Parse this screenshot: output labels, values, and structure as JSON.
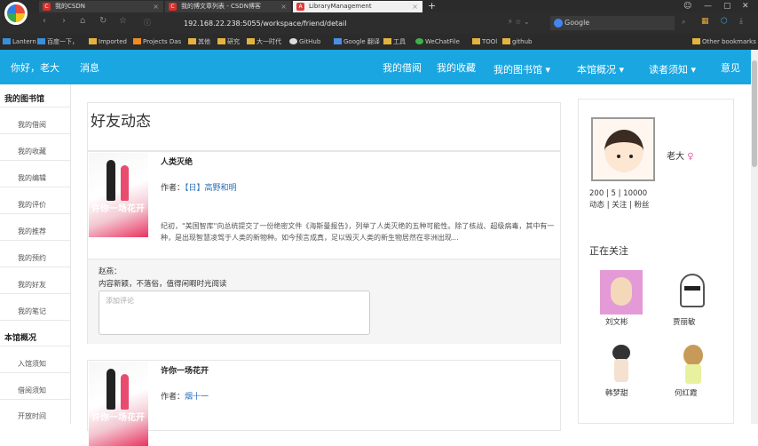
{
  "browser": {
    "tabs": [
      {
        "title": "我的CSDN",
        "active": false
      },
      {
        "title": "我的博文章列表 - CSDN博客",
        "active": false
      },
      {
        "title": "LibraryManagement",
        "active": true
      }
    ],
    "url": "192.168.22.238:5055/workspace/friend/detail",
    "search_placeholder": "Google",
    "bookmarks": [
      "Lantern",
      "百度一下，",
      "Imported",
      "Projects Das",
      "其他",
      "研究",
      "大一时代",
      "GitHub",
      "Google 翻译",
      "工具",
      "WeChatFile",
      "TOOl",
      "github",
      "Other bookmarks"
    ]
  },
  "topnav": {
    "greeting": "你好，老大",
    "messages": "消息",
    "my_borrow": "我的借阅",
    "my_favorites": "我的收藏",
    "my_library": "我的图书馆",
    "library_overview": "本馆概况",
    "reader_notice": "读者须知",
    "feedback": "意见"
  },
  "sidebar": {
    "section1": "我的图书馆",
    "items1": [
      "我的借阅",
      "我的收藏",
      "我的编辑",
      "我的评价",
      "我的推荐",
      "我的预约",
      "我的好友",
      "我的笔记"
    ],
    "section2": "本馆概况",
    "items2": [
      "入馆须知",
      "借阅须知",
      "开放时间"
    ]
  },
  "main": {
    "title": "好友动态",
    "cards": [
      {
        "book_title": "人类灭绝",
        "author_label": "作者：",
        "author": "【日】高野和明",
        "cover_text": "许你一场花开",
        "description": "纪初，\"美国智库\"向总统提交了一份绝密文件《海斯曼报告》，列举了人类灭绝的五种可能性。除了核战、超级病毒，其中有一种，是出现智慧凌驾于人类的新物种。如今预言成真，足以毁灭人类的新生物居然在非洲出现...",
        "comment_user": "赵燕：",
        "comment_text": "内容新颖，不落俗，值得闲暇时光阅读",
        "comment_placeholder": "添加评论"
      },
      {
        "book_title": "许你一场花开",
        "author_label": "作者：",
        "author": "烟十一",
        "cover_text": "许你一场花开"
      }
    ]
  },
  "profile": {
    "name": "老大",
    "gender_icon": "female-icon",
    "stats_values": "200  |   5   | 10000",
    "stats_labels": "动态 | 关注 | 粉丝",
    "following_title": "正在关注",
    "following": [
      "刘文彬",
      "贾丽敏",
      "韩梦甜",
      "何红霞"
    ]
  },
  "colors": {
    "nav": "#1aa6e1",
    "link": "#2a6fb6",
    "accent_pink": "#e9345f"
  }
}
